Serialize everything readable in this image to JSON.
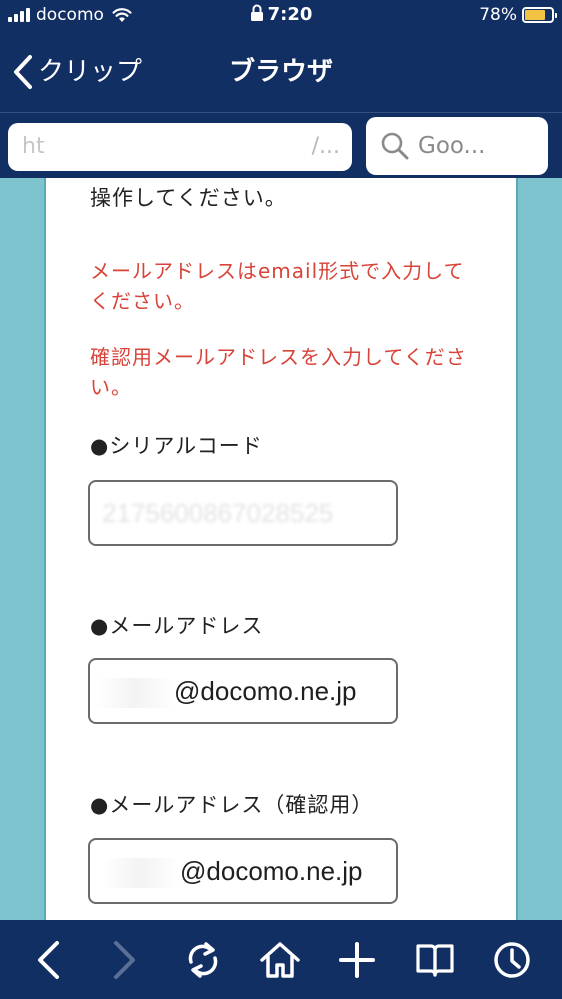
{
  "status_bar": {
    "carrier": "docomo",
    "time": "7:20",
    "battery": "78%",
    "battery_level": 0.78,
    "battery_color": "#f3c243"
  },
  "nav": {
    "back_label": "クリップ",
    "title": "ブラウザ"
  },
  "toolbar": {
    "url_prefix": "ht",
    "url_suffix": "/...",
    "search_placeholder": "Goo..."
  },
  "content": {
    "instruction": "操作してください。",
    "errors": [
      "メールアドレスはemail形式で入力してください。",
      "確認用メールアドレスを入力してください。"
    ],
    "fields": [
      {
        "label": "●シリアルコード",
        "value_visible": "",
        "value_obscured": "2175600867028525"
      },
      {
        "label": "●メールアドレス",
        "value_visible": "@docomo.ne.jp",
        "value_obscured": ""
      },
      {
        "label": "●メールアドレス（確認用）",
        "value_visible": "@docomo.ne.jp",
        "value_obscured": ""
      }
    ],
    "error_color": "#d8443a"
  },
  "bottom_bar": {
    "icons": [
      "back-arrow-icon",
      "forward-arrow-icon",
      "reload-icon",
      "home-icon",
      "plus-icon",
      "bookmarks-icon",
      "history-icon"
    ]
  },
  "colors": {
    "nav_background": "#122f63",
    "page_background": "#7ec4cf"
  }
}
